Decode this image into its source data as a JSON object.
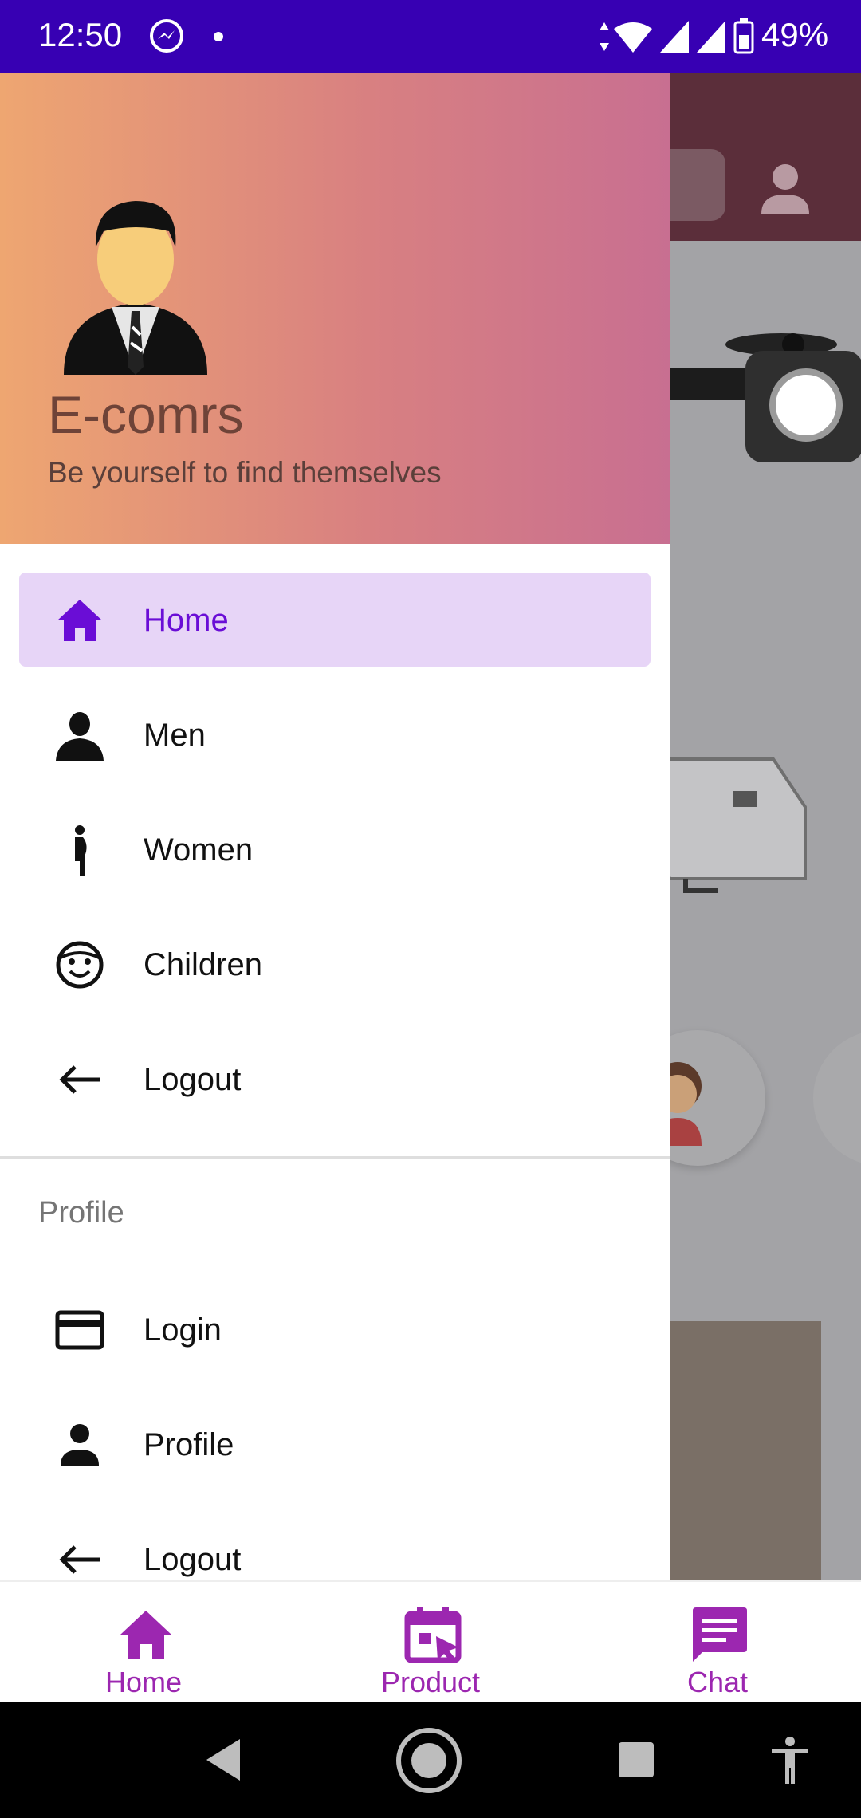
{
  "status_bar": {
    "time": "12:50",
    "battery_percent": "49%",
    "icons": [
      "messenger-icon",
      "notification-dot",
      "data-arrows-icon",
      "wifi-icon",
      "signal-icon",
      "signal-icon",
      "battery-icon"
    ]
  },
  "drawer": {
    "header": {
      "title": "E-comrs",
      "subtitle": "Be yourself to find themselves"
    },
    "items": [
      {
        "label": "Home",
        "icon": "home-icon",
        "active": true
      },
      {
        "label": "Men",
        "icon": "man-icon"
      },
      {
        "label": "Women",
        "icon": "pregnant-woman-icon"
      },
      {
        "label": "Children",
        "icon": "child-face-icon"
      },
      {
        "label": "Logout",
        "icon": "arrow-back-icon"
      }
    ],
    "profile_section": {
      "title": "Profile",
      "items": [
        {
          "label": "Login",
          "icon": "credit-card-icon"
        },
        {
          "label": "Profile",
          "icon": "person-icon"
        },
        {
          "label": "Logout",
          "icon": "arrow-back-icon"
        }
      ]
    }
  },
  "bottom_nav": {
    "items": [
      {
        "label": "Home",
        "icon": "home-icon"
      },
      {
        "label": "Product",
        "icon": "calendar-select-icon"
      },
      {
        "label": "Chat",
        "icon": "chat-icon"
      }
    ]
  },
  "colors": {
    "status_bar": "#3700b3",
    "accent": "#6a0dd6",
    "active_highlight": "#e7d5f7",
    "bottom_nav_accent": "#9c27b0",
    "header_gradient_start": "#eea671",
    "header_gradient_end": "#c86f91"
  }
}
